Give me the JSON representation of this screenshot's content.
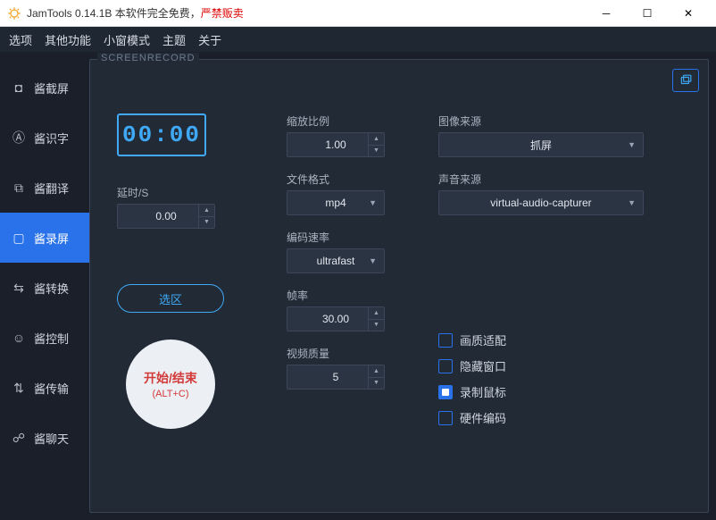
{
  "titlebar": {
    "app_name": "JamTools 0.14.1B 本软件完全免费，",
    "app_name_red": "严禁贩卖"
  },
  "menu": {
    "options": "选项",
    "other": "其他功能",
    "mini": "小窗模式",
    "theme": "主题",
    "about": "关于"
  },
  "sidebar": {
    "items": [
      {
        "label": "酱截屏"
      },
      {
        "label": "酱识字"
      },
      {
        "label": "酱翻译"
      },
      {
        "label": "酱录屏"
      },
      {
        "label": "酱转换"
      },
      {
        "label": "酱控制"
      },
      {
        "label": "酱传输"
      },
      {
        "label": "酱聊天"
      }
    ],
    "active_index": 3
  },
  "panel": {
    "title": "SCREENRECORD",
    "timer": "00:00",
    "delay_label": "延时/S",
    "delay_value": "0.00",
    "scale_label": "缩放比例",
    "scale_value": "1.00",
    "format_label": "文件格式",
    "format_value": "mp4",
    "speed_label": "编码速率",
    "speed_value": "ultrafast",
    "fps_label": "帧率",
    "fps_value": "30.00",
    "quality_label": "视频质量",
    "quality_value": "5",
    "imgsrc_label": "图像来源",
    "imgsrc_value": "抓屏",
    "audiosrc_label": "声音来源",
    "audiosrc_value": "virtual-audio-capturer",
    "region_btn": "选区",
    "record_btn_l1": "开始/结束",
    "record_btn_l2": "(ALT+C)",
    "check_quality": "画质适配",
    "check_hide": "隐藏窗口",
    "check_mouse": "录制鼠标",
    "check_hw": "硬件编码",
    "mouse_checked": true
  }
}
